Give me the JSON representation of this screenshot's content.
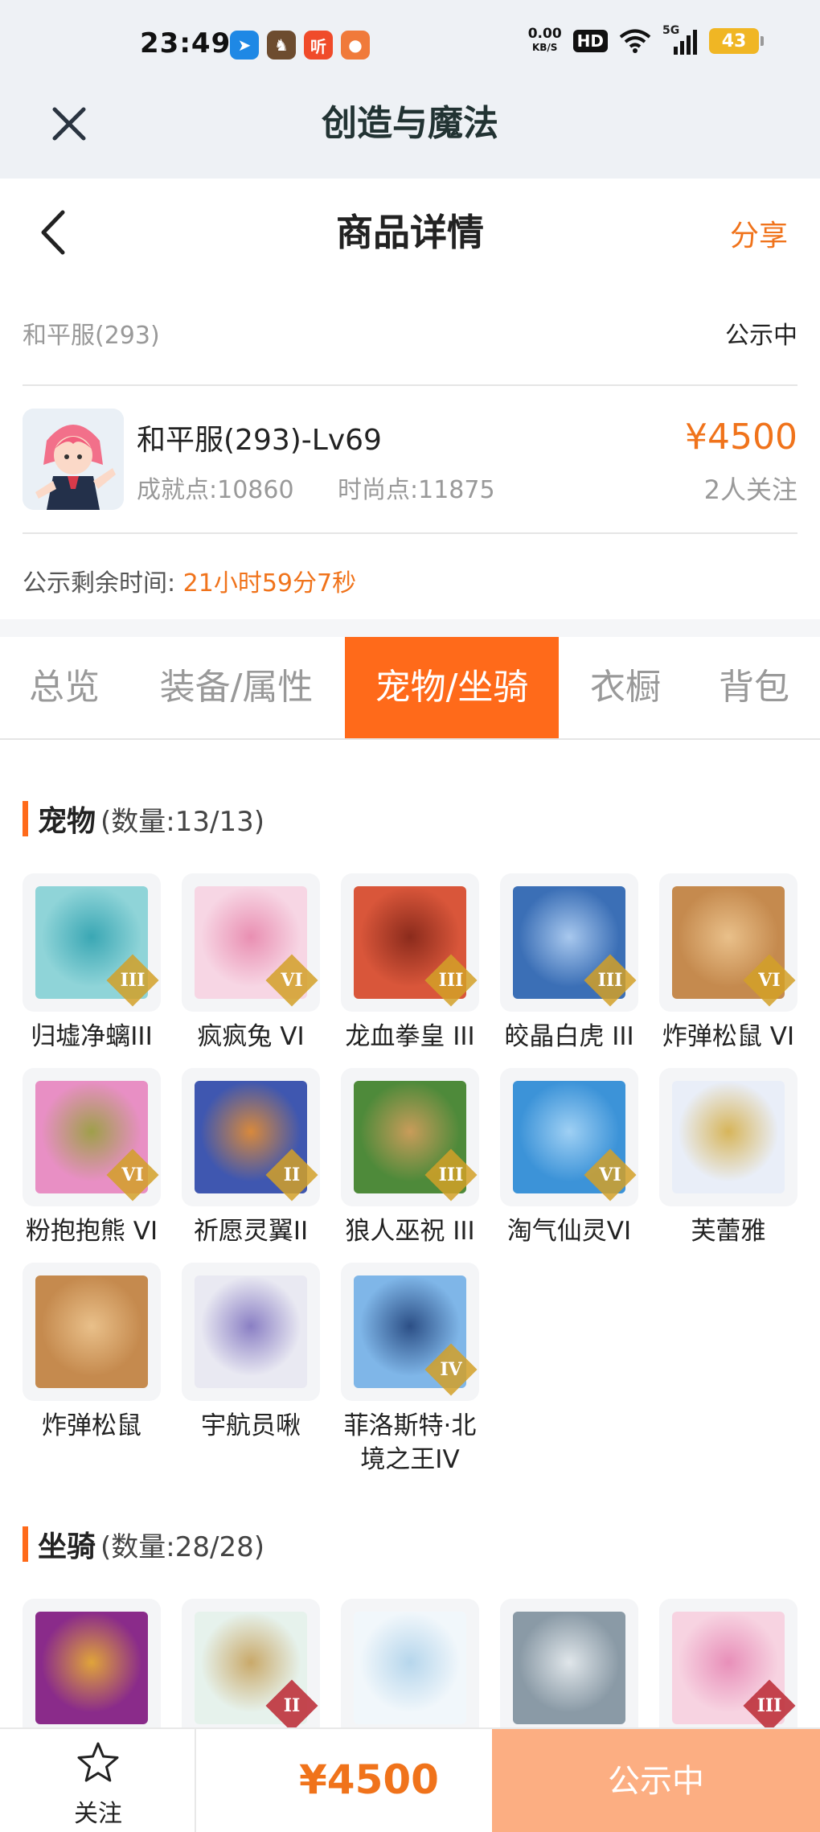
{
  "status_bar": {
    "time": "23:49",
    "net_speed_value": "0.00",
    "net_speed_unit": "KB/S",
    "hd": "HD",
    "network": "5G",
    "battery": "43",
    "notif_text": "听"
  },
  "app_header": {
    "title": "创造与魔法"
  },
  "page_header": {
    "title": "商品详情",
    "share_label": "分享"
  },
  "summary": {
    "server": "和平服(293)",
    "status": "公示中",
    "product_name": "和平服(293)-Lv69",
    "achievement": "成就点:10860",
    "fashion": "时尚点:11875",
    "price": "¥4500",
    "followers": "2人关注",
    "remain_label": "公示剩余时间:",
    "remain_value": "21小时59分7秒"
  },
  "tabs": [
    "总览",
    "装备/属性",
    "宠物/坐骑",
    "衣橱",
    "背包"
  ],
  "active_tab": "宠物/坐骑",
  "pets": {
    "title": "宠物",
    "count": "(数量:13/13)",
    "items": [
      {
        "name": "归墟净螭III",
        "badge": "III"
      },
      {
        "name": "疯疯兔 VI",
        "badge": "VI"
      },
      {
        "name": "龙血拳皇 III",
        "badge": "III"
      },
      {
        "name": "皎晶白虎 III",
        "badge": "III"
      },
      {
        "name": "炸弹松鼠 VI",
        "badge": "VI"
      },
      {
        "name": "粉抱抱熊 VI",
        "badge": "VI"
      },
      {
        "name": "祈愿灵翼II",
        "badge": "II"
      },
      {
        "name": "狼人巫祝 III",
        "badge": "III"
      },
      {
        "name": "淘气仙灵VI",
        "badge": "VI"
      },
      {
        "name": "芙蕾雅",
        "badge": ""
      },
      {
        "name": "炸弹松鼠",
        "badge": ""
      },
      {
        "name": "宇航员啾",
        "badge": ""
      },
      {
        "name": "菲洛斯特·北境之王IV",
        "badge": "IV"
      }
    ]
  },
  "mounts": {
    "title": "坐骑",
    "count": "(数量:28/28)",
    "items": [
      {
        "badge": ""
      },
      {
        "badge": "II"
      },
      {
        "badge": ""
      },
      {
        "badge": ""
      },
      {
        "badge": "III"
      }
    ]
  },
  "bottom_bar": {
    "follow_label": "关注",
    "price": "¥4500",
    "action_label": "公示中"
  },
  "colors": {
    "accent": "#ff6a1a",
    "price": "#f0731b",
    "action_button": "#fcae82"
  }
}
